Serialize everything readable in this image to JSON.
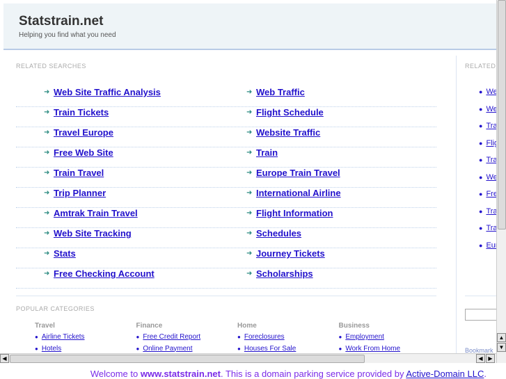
{
  "header": {
    "title": "Statstrain.net",
    "tagline": "Helping you find what you need"
  },
  "related": {
    "heading": "RELATED SEARCHES",
    "left": [
      "Web Site Traffic Analysis",
      "Train Tickets",
      "Travel Europe",
      "Free Web Site",
      "Train Travel",
      "Trip Planner",
      "Amtrak Train Travel",
      "Web Site Tracking",
      "Stats",
      "Free Checking Account"
    ],
    "right": [
      "Web Traffic",
      "Flight Schedule",
      "Website Traffic",
      "Train",
      "Europe Train Travel",
      "International Airline",
      "Flight Information",
      "Schedules",
      "Journey Tickets",
      "Scholarships"
    ]
  },
  "sidebar": {
    "heading": "RELATED",
    "items": [
      "Web Site Traffic Analysis",
      "Web Traffic",
      "Train Tickets",
      "Flight Schedule",
      "Travel Europe",
      "Website Traffic",
      "Free Web Site",
      "Train",
      "Train Travel",
      "Europe Train Travel"
    ],
    "bookmark": "Bookmark"
  },
  "popular": {
    "heading": "POPULAR CATEGORIES",
    "categories": [
      {
        "name": "Travel",
        "items": [
          "Airline Tickets",
          "Hotels"
        ]
      },
      {
        "name": "Finance",
        "items": [
          "Free Credit Report",
          "Online Payment"
        ]
      },
      {
        "name": "Home",
        "items": [
          "Foreclosures",
          "Houses For Sale"
        ]
      },
      {
        "name": "Business",
        "items": [
          "Employment",
          "Work From Home"
        ]
      }
    ]
  },
  "footer": {
    "prefix": "Welcome to ",
    "domain": "www.statstrain.net",
    "middle": ". This is a domain parking service provided by ",
    "link": "Active-Domain LLC",
    "suffix": "."
  }
}
